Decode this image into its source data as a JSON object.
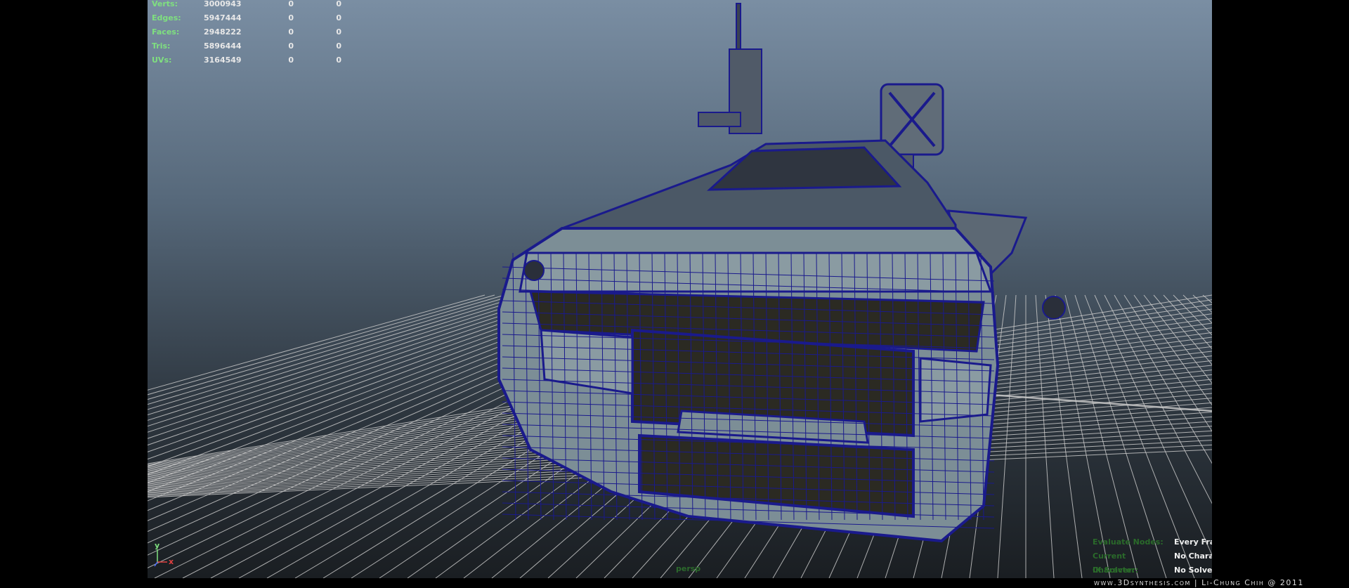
{
  "hud": {
    "rows": [
      {
        "label": "Verts:",
        "value": "3000943",
        "c1": "0",
        "c2": "0"
      },
      {
        "label": "Edges:",
        "value": "5947444",
        "c1": "0",
        "c2": "0"
      },
      {
        "label": "Faces:",
        "value": "2948222",
        "c1": "0",
        "c2": "0"
      },
      {
        "label": "Tris:",
        "value": "5896444",
        "c1": "0",
        "c2": "0"
      },
      {
        "label": "UVs:",
        "value": "3164549",
        "c1": "0",
        "c2": "0"
      }
    ]
  },
  "axis": {
    "y_label": "y",
    "x_label": "x",
    "y_color": "#7fe07f",
    "x_color": "#e04040",
    "z_color": "#4a6cff"
  },
  "camera": {
    "name": "persp"
  },
  "status": {
    "rows": [
      {
        "label": "Evaluate Nodes:",
        "value": "Every Fran"
      },
      {
        "label": "Current Character:",
        "value": "No Charac"
      },
      {
        "label": "IK Solver:",
        "value": "No Solver"
      }
    ]
  },
  "credit": "www.3Dsynthesis.com | Li-Chung Chih @ 2011",
  "colors": {
    "wire": "#1a1a8c",
    "body": "#7c8e96",
    "dark": "#2b2a22",
    "grid": "#cfcfcf"
  }
}
